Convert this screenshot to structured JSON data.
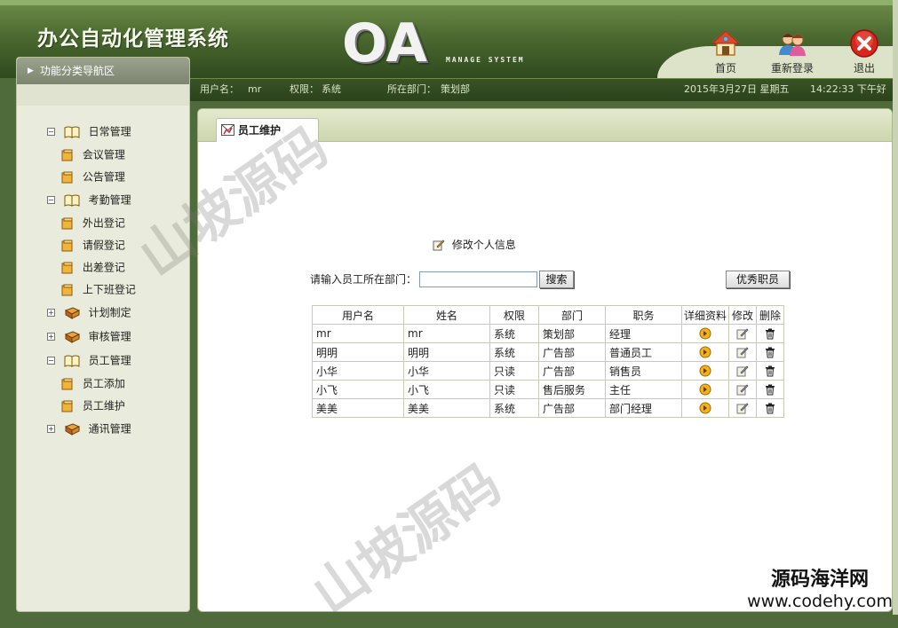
{
  "header": {
    "system_title": "办公自动化管理系统",
    "logo_text": "OA",
    "logo_subtitle": "MANAGE SYSTEM",
    "buttons": [
      {
        "label": "首页",
        "icon": "home-icon"
      },
      {
        "label": "重新登录",
        "icon": "users-icon"
      },
      {
        "label": "退出",
        "icon": "exit-icon"
      }
    ]
  },
  "infobar": {
    "username_label": "用户名：",
    "username": "mr",
    "permission_label": "权限：",
    "permission": "系统",
    "department_label": "所在部门：",
    "department": "策划部",
    "date": "2015年3月27日 星期五",
    "time": "14:22:33 下午好"
  },
  "sidebar": {
    "header": "功能分类导航区",
    "items": [
      {
        "label": "日常管理",
        "level": 0,
        "expanded": true,
        "icon": "book-open-icon"
      },
      {
        "label": "会议管理",
        "level": 1,
        "icon": "folder-icon"
      },
      {
        "label": "公告管理",
        "level": 1,
        "icon": "folder-icon"
      },
      {
        "label": "考勤管理",
        "level": 0,
        "expanded": true,
        "icon": "book-open-icon"
      },
      {
        "label": "外出登记",
        "level": 1,
        "icon": "folder-icon"
      },
      {
        "label": "请假登记",
        "level": 1,
        "icon": "folder-icon"
      },
      {
        "label": "出差登记",
        "level": 1,
        "icon": "folder-icon"
      },
      {
        "label": "上下班登记",
        "level": 1,
        "icon": "folder-icon"
      },
      {
        "label": "计划制定",
        "level": 0,
        "expanded": false,
        "icon": "book-closed-icon"
      },
      {
        "label": "审核管理",
        "level": 0,
        "expanded": false,
        "icon": "book-closed-icon"
      },
      {
        "label": "员工管理",
        "level": 0,
        "expanded": true,
        "icon": "book-open-icon"
      },
      {
        "label": "员工添加",
        "level": 1,
        "icon": "folder-icon"
      },
      {
        "label": "员工维护",
        "level": 1,
        "icon": "folder-icon"
      },
      {
        "label": "通讯管理",
        "level": 0,
        "expanded": false,
        "icon": "book-closed-icon"
      }
    ]
  },
  "main": {
    "tab_label": "员工维护",
    "edit_link": "修改个人信息",
    "search_label": "请输入员工所在部门：",
    "search_value": "",
    "search_button": "搜索",
    "excellent_button": "优秀职员",
    "table": {
      "columns": [
        "用户名",
        "姓名",
        "权限",
        "部门",
        "职务",
        "详细资料",
        "修改",
        "删除"
      ],
      "rows": [
        [
          "mr",
          "mr",
          "系统",
          "策划部",
          "经理"
        ],
        [
          "明明",
          "明明",
          "系统",
          "广告部",
          "普通员工"
        ],
        [
          "小华",
          "小华",
          "只读",
          "广告部",
          "销售员"
        ],
        [
          "小飞",
          "小飞",
          "只读",
          "售后服务",
          "主任"
        ],
        [
          "美美",
          "美美",
          "系统",
          "广告部",
          "部门经理"
        ]
      ]
    }
  },
  "watermarks": {
    "text": "山坡源码",
    "corner_line1": "源码海洋网",
    "corner_line2": "www.codehy.com"
  },
  "colors": {
    "header_green": "#4c6a31",
    "sidebar_bg": "#e9ecdc",
    "tab_bar": "#ccd6ad"
  }
}
